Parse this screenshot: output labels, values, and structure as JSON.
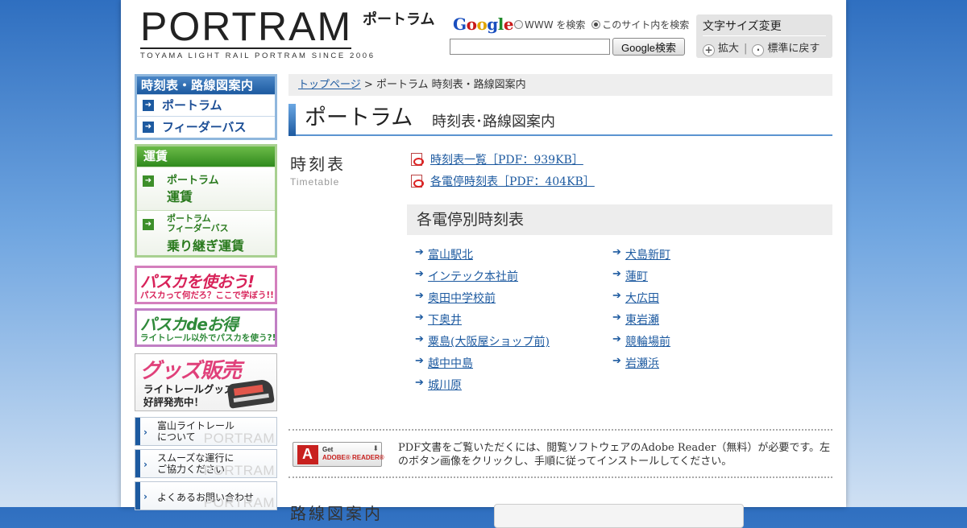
{
  "header": {
    "logo_main": "PORTRAM",
    "logo_kana": "ポートラム",
    "logo_sub": "TOYAMA LIGHT RAIL PORTRAM SINCE 2006",
    "google": {
      "word": [
        "G",
        "o",
        "o",
        "g",
        "l",
        "e"
      ],
      "radio_www": "WWW を検索",
      "radio_site": "このサイト内を検索",
      "selected": "site",
      "input_value": "",
      "button": "Google検索"
    },
    "font_size": {
      "title": "文字サイズ変更",
      "enlarge": "拡大",
      "reset": "標準に戻す"
    }
  },
  "sidebar": {
    "timetable_box": {
      "header": "時刻表・路線図案内",
      "items": [
        "ポートラム",
        "フィーダーバス"
      ]
    },
    "fare_box": {
      "header": "運賃",
      "item1_line1": "ポートラム",
      "item1_line2": "運賃",
      "item2_line1": "ポートラム",
      "item2_line2": "フィーダーバス",
      "item2_line3": "乗り継ぎ運賃"
    },
    "banners": {
      "pasuka1_title": "パスカを使おう!",
      "pasuka1_sub": "パスカって何だろ？ここで学ぼう!!",
      "pasuka2_title": "パスカdeお得",
      "pasuka2_sub": "ライトレール以外でパスカを使う?!",
      "goods_title": "グッズ販売",
      "goods_sub1": "ライトレールグッズ,",
      "goods_sub2": "好評発売中！"
    },
    "links": [
      {
        "line1": "富山ライトレール",
        "line2": "について"
      },
      {
        "line1": "スムーズな運行に",
        "line2": "ご協力ください"
      },
      {
        "line1": "よくあるお問い合わせ",
        "line2": ""
      }
    ],
    "link_watermark": "PORTRAM"
  },
  "main": {
    "breadcrumb": {
      "home": "トップページ",
      "separator": ">",
      "current": "ポートラム 時刻表・路線図案内"
    },
    "title": "ポートラム",
    "subtitle": "時刻表･路線図案内",
    "timetable": {
      "heading": "時刻表",
      "heading_en": "Timetable",
      "pdf_links": [
        "時刻表一覧［PDF：939KB］",
        "各電停時刻表［PDF：404KB］"
      ]
    },
    "stops": {
      "header": "各電停別時刻表",
      "left": [
        "富山駅北",
        "インテック本社前",
        "奥田中学校前",
        "下奥井",
        "粟島(大阪屋ショップ前)",
        "越中中島",
        "城川原"
      ],
      "right": [
        "犬島新町",
        "蓮町",
        "大広田",
        "東岩瀬",
        "競輪場前",
        "岩瀬浜"
      ]
    },
    "adobe": {
      "get": "Get",
      "reader": "ADOBE® READER®",
      "text": "PDF文書をご覧いただくには、閲覧ソフトウェアのAdobe Reader（無料）が必要です。左のボタン画像をクリックし、手順に従ってインストールしてください。"
    },
    "next_heading": "路線図案内"
  },
  "colors": {
    "accent_blue": "#1d5aa0",
    "accent_green": "#2f8a1d",
    "link": "#1d5aa0"
  }
}
